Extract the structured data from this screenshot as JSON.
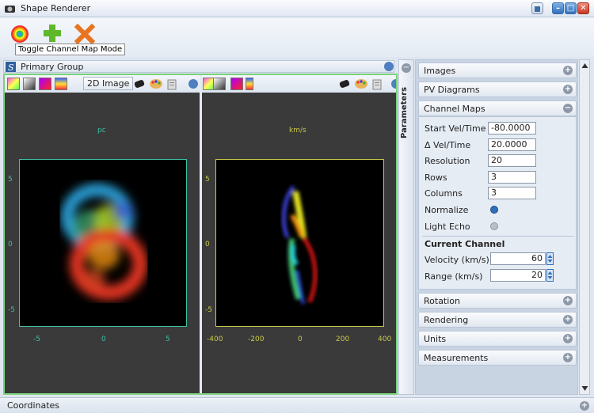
{
  "window": {
    "title": "Shape Renderer"
  },
  "toolbar": {
    "tooltip": "Toggle Channel Map Mode"
  },
  "group": {
    "title": "Primary Group"
  },
  "left_panel": {
    "mode_button": "2D Image",
    "unit_label": "pc",
    "x_ticks": [
      "-5",
      "0",
      "5"
    ],
    "y_ticks": [
      "5",
      "0",
      "-5"
    ]
  },
  "right_panel": {
    "unit_label": "km/s",
    "x_ticks": [
      "-400",
      "-200",
      "0",
      "200",
      "400"
    ],
    "y_ticks": [
      "5",
      "0",
      "-5"
    ]
  },
  "sidebar": {
    "tab_label": "Parameters",
    "sections": {
      "images": "Images",
      "pv": "PV Diagrams",
      "channel_maps": "Channel Maps",
      "rotation": "Rotation",
      "rendering": "Rendering",
      "units": "Units",
      "measurements": "Measurements"
    },
    "params": {
      "start_vel_label": "Start Vel/Time",
      "start_vel": "-80.0000",
      "delta_vel_label": "Δ Vel/Time",
      "delta_vel": "20.0000",
      "resolution_label": "Resolution",
      "resolution": "20",
      "rows_label": "Rows",
      "rows": "3",
      "columns_label": "Columns",
      "columns": "3",
      "normalize_label": "Normalize",
      "light_echo_label": "Light Echo"
    },
    "current_channel": {
      "title": "Current Channel",
      "velocity_label": "Velocity (km/s)",
      "velocity": "60",
      "range_label": "Range (km/s)",
      "range": "20"
    }
  },
  "status": {
    "coordinates_label": "Coordinates"
  },
  "colors": {
    "accent_green": "#7bd17b",
    "left_axis": "#3fc1a5",
    "right_axis": "#c8c84a"
  }
}
